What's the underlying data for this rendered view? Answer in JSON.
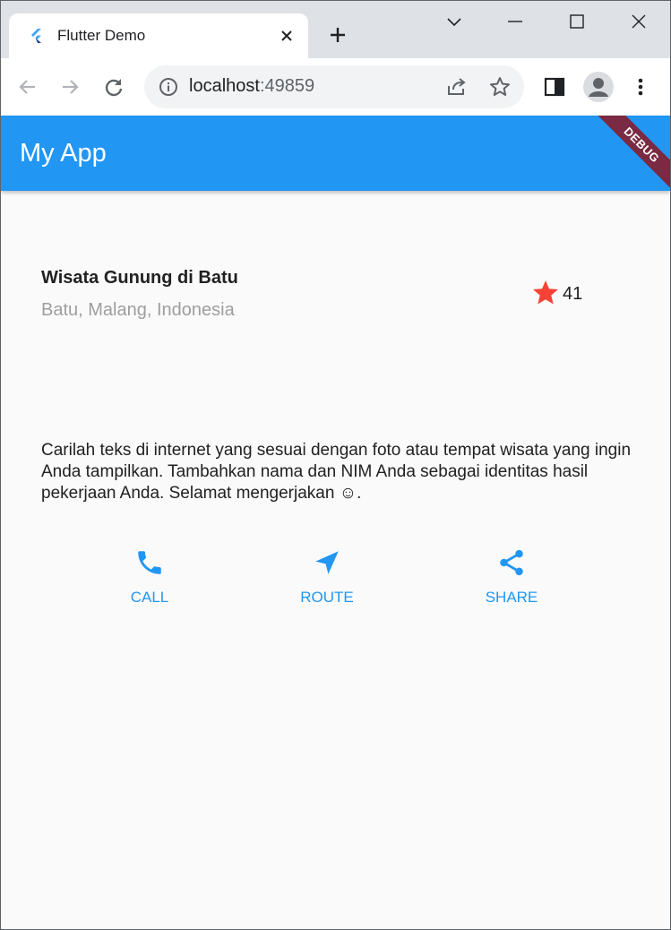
{
  "browser": {
    "tab": {
      "title": "Flutter Demo",
      "favicon": "flutter-logo-icon",
      "close_icon": "close-icon"
    },
    "new_tab_icon": "plus-icon",
    "window_controls": [
      "chevron-down-icon",
      "minimize-icon",
      "maximize-icon",
      "close-icon"
    ],
    "toolbar": {
      "back_icon": "arrow-left-icon",
      "forward_icon": "arrow-right-icon",
      "reload_icon": "reload-icon",
      "url_host": "localhost",
      "url_port": ":49859",
      "info_icon": "info-icon",
      "share_icon": "share-page-icon",
      "bookmark_icon": "star-outline-icon",
      "side_panel_icon": "side-panel-icon",
      "profile_icon": "person-icon",
      "menu_icon": "kebab-menu-icon"
    }
  },
  "app": {
    "title": "My App",
    "debug_banner": "DEBUG",
    "primary_color": "#2196f3",
    "title_section": {
      "name": "Wisata Gunung di Batu",
      "location": "Batu, Malang, Indonesia",
      "star_icon": "star-icon",
      "star_color": "#f44336",
      "rating": "41"
    },
    "description": "Carilah teks di internet yang sesuai dengan foto atau tempat wisata yang ingin Anda tampilkan. Tambahkan nama dan NIM Anda sebagai identitas hasil pekerjaan Anda. Selamat mengerjakan ☺.",
    "actions": [
      {
        "label": "CALL",
        "icon": "phone-icon"
      },
      {
        "label": "ROUTE",
        "icon": "navigation-icon"
      },
      {
        "label": "SHARE",
        "icon": "share-icon"
      }
    ]
  }
}
